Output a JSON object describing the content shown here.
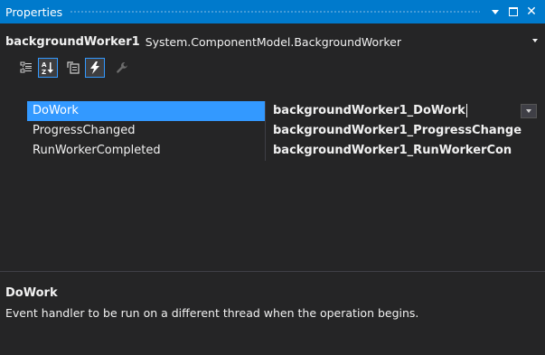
{
  "window": {
    "title": "Properties"
  },
  "object_selector": {
    "name": "backgroundWorker1",
    "type": "System.ComponentModel.BackgroundWorker"
  },
  "toolbar": {
    "buttons": [
      {
        "icon": "categorized-icon",
        "active": false
      },
      {
        "icon": "alphabetical-icon",
        "active": true
      },
      {
        "icon": "properties-icon",
        "active": false
      },
      {
        "icon": "events-lightning-icon",
        "active": true
      },
      {
        "icon": "property-pages-wrench-icon",
        "active": false
      }
    ]
  },
  "events": [
    {
      "name": "DoWork",
      "value": "backgroundWorker1_DoWork",
      "selected": true
    },
    {
      "name": "ProgressChanged",
      "value": "backgroundWorker1_ProgressChange",
      "selected": false
    },
    {
      "name": "RunWorkerCompleted",
      "value": "backgroundWorker1_RunWorkerCon",
      "selected": false
    }
  ],
  "description": {
    "title": "DoWork",
    "text": "Event handler to be run on a different thread when the operation begins."
  },
  "colors": {
    "title_bar": "#007acc",
    "background": "#252526",
    "selection": "#3399ff",
    "text": "#f1f1f1"
  }
}
